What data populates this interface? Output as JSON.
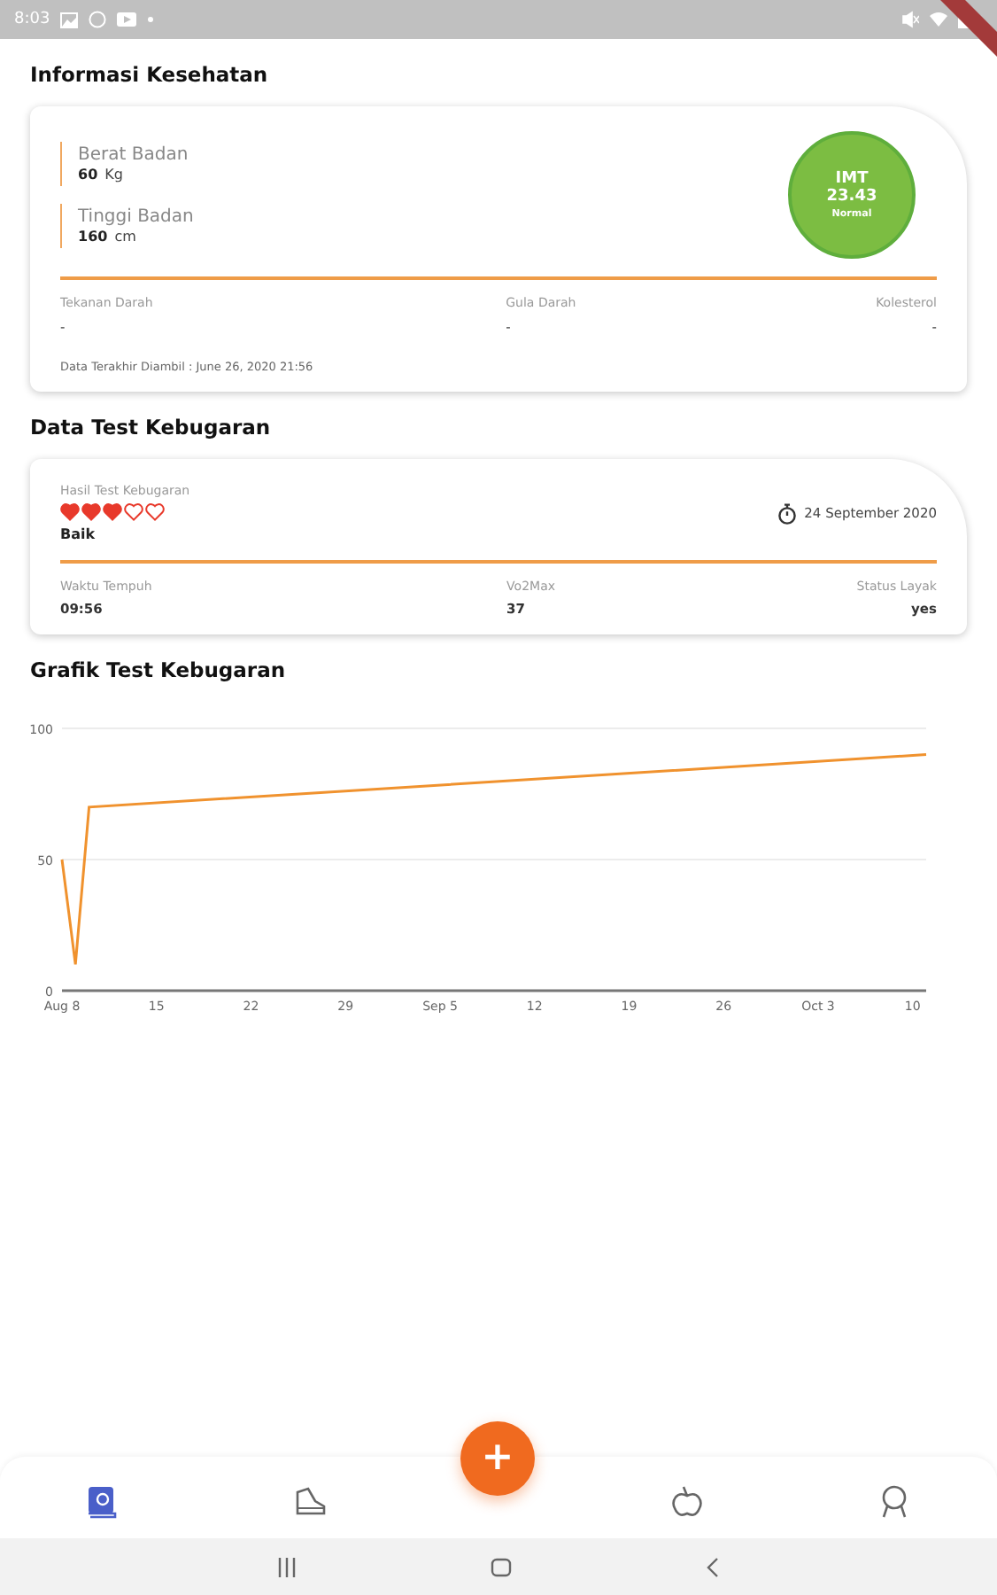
{
  "status_bar": {
    "time": "8:03"
  },
  "health": {
    "title": "Informasi Kesehatan",
    "measures": [
      {
        "label": "Berat Badan",
        "value": "60",
        "unit": "Kg"
      },
      {
        "label": "Tinggi Badan",
        "value": "160",
        "unit": "cm"
      }
    ],
    "bmi": {
      "label": "IMT",
      "value": "23.43",
      "category": "Normal",
      "color": "#7cbd42"
    },
    "stats": [
      {
        "label": "Tekanan Darah",
        "value": "-"
      },
      {
        "label": "Gula Darah",
        "value": "-"
      },
      {
        "label": "Kolesterol",
        "value": "-"
      }
    ],
    "last_taken": "Data Terakhir Diambil : June 26, 2020 21:56"
  },
  "fitness": {
    "title": "Data Test Kebugaran",
    "result_label": "Hasil Test Kebugaran",
    "stars": 3,
    "result": "Baik",
    "date": "24 September 2020",
    "stats": [
      {
        "label": "Waktu Tempuh",
        "value": "09:56"
      },
      {
        "label": "Vo2Max",
        "value": "37"
      },
      {
        "label": "Status Layak",
        "value": "yes"
      }
    ]
  },
  "chart": {
    "title": "Grafik Test Kebugaran",
    "chart_data": {
      "type": "line",
      "x": [
        "2020-08-08",
        "2020-08-09",
        "2020-08-10",
        "2020-10-11"
      ],
      "series": [
        {
          "color": "#f0922e",
          "values": [
            50,
            10,
            70,
            90
          ]
        }
      ],
      "xlim": [
        "2020-08-08",
        "2020-10-11"
      ],
      "ylim": [
        0,
        100
      ],
      "yticks": [
        0,
        50,
        100
      ],
      "xticks": [
        {
          "value": "2020-08-08",
          "label": "Aug 8"
        },
        {
          "value": "2020-08-15",
          "label": "15"
        },
        {
          "value": "2020-08-22",
          "label": "22"
        },
        {
          "value": "2020-08-29",
          "label": "29"
        },
        {
          "value": "2020-09-05",
          "label": "Sep 5"
        },
        {
          "value": "2020-09-12",
          "label": "12"
        },
        {
          "value": "2020-09-19",
          "label": "19"
        },
        {
          "value": "2020-09-26",
          "label": "26"
        },
        {
          "value": "2020-10-03",
          "label": "Oct 3"
        },
        {
          "value": "2020-10-10",
          "label": "10"
        }
      ]
    }
  },
  "fab": {
    "label": "+"
  },
  "nav": [
    {
      "kind": "book",
      "selected": true
    },
    {
      "kind": "shoe",
      "selected": false
    },
    {
      "kind": "apple",
      "selected": false
    },
    {
      "kind": "medal",
      "selected": false
    }
  ]
}
